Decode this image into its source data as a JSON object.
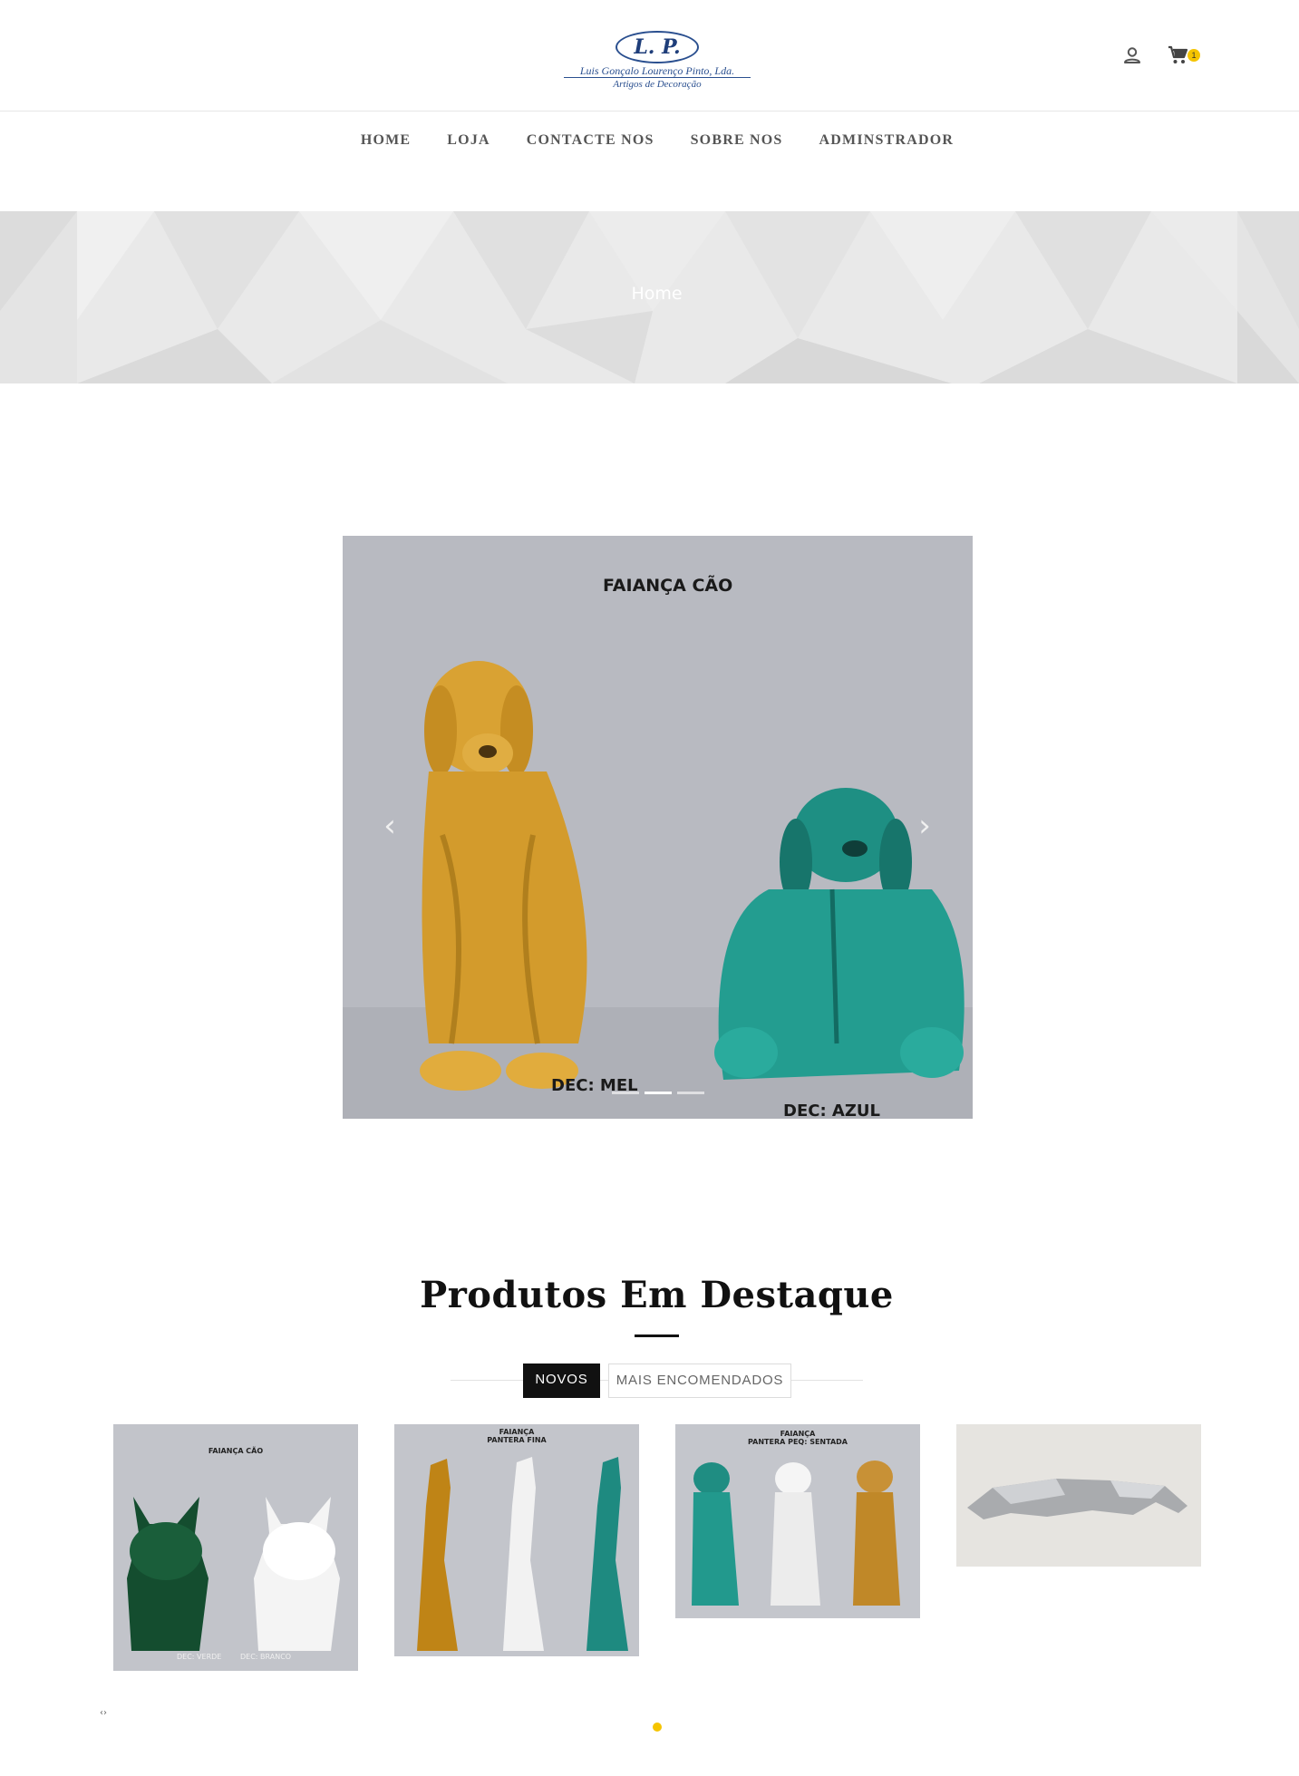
{
  "brand": {
    "logo_initials": "L. P.",
    "logo_company": "Luis Gonçalo Lourenço Pinto, Lda.",
    "logo_tagline": "Artigos de Decoração"
  },
  "header": {
    "cart_count": "1"
  },
  "nav": {
    "items": [
      "HOME",
      "LOJA",
      "CONTACTE NOS",
      "SOBRE NOS",
      "ADMINSTRADOR"
    ]
  },
  "banner": {
    "title": "Home"
  },
  "slider": {
    "caption": "FAIANÇA CÃO",
    "label_left": "DEC: MEL",
    "label_right": "DEC: AZUL",
    "prev_icon": "chevron-left-icon",
    "next_icon": "chevron-right-icon",
    "slide_count": 3,
    "active_slide": 1
  },
  "featured": {
    "title": "Produtos Em Destaque",
    "tabs": [
      "NOVOS",
      "MAIS ENCOMENDADOS"
    ],
    "active_tab": "NOVOS",
    "products": [
      {
        "caption": "FAIANÇA CÃO",
        "dec_left": "DEC: VERDE",
        "dec_right": "DEC: BRANCO"
      },
      {
        "caption_line1": "FAIANÇA",
        "caption_line2": "PANTERA FINA"
      },
      {
        "caption_line1": "FAIANÇA",
        "caption_line2": "PANTERA PEQ: SENTADA"
      },
      {
        "caption": ""
      }
    ]
  },
  "colors": {
    "accent": "#f5c400",
    "text_dark": "#111111",
    "logo_blue": "#2a4f8f",
    "banner_bg": "#e3e3e3"
  }
}
